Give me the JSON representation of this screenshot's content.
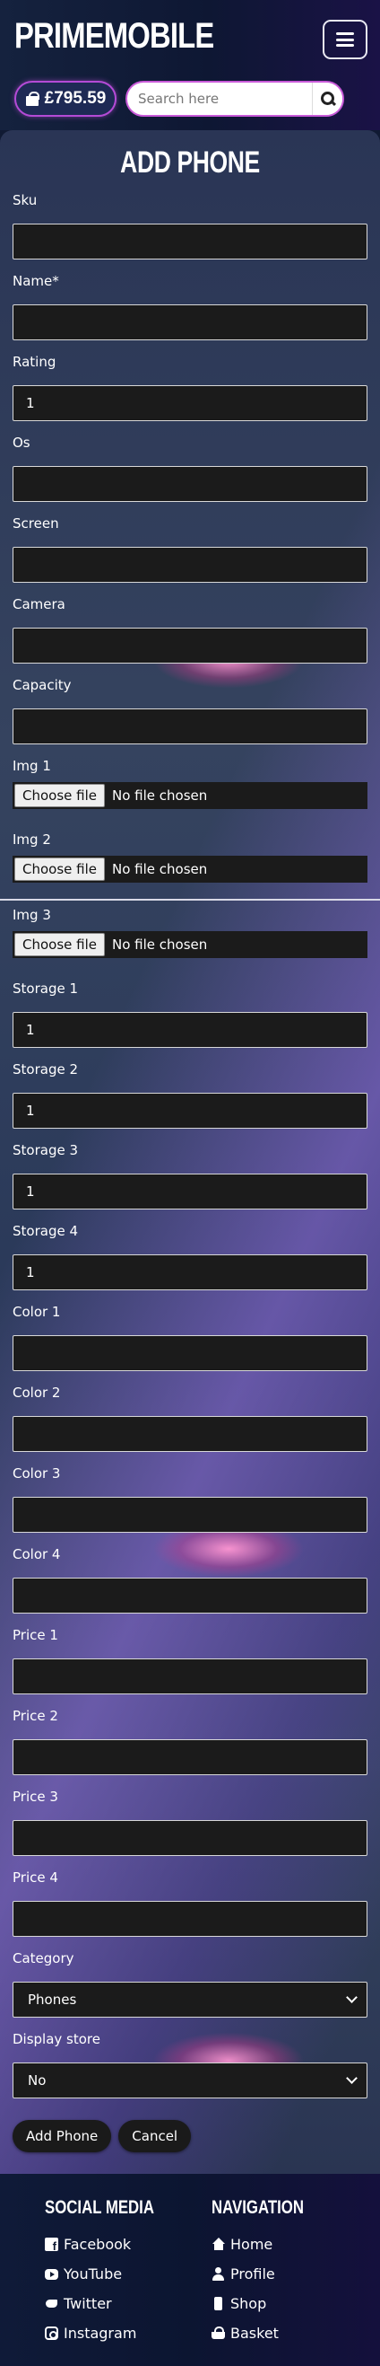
{
  "header": {
    "brand": "PRIMEMOBILE",
    "basket_total": "£795.59",
    "search_placeholder": "Search here"
  },
  "form": {
    "title": "ADD PHONE",
    "fields_top": [
      {
        "label": "Sku",
        "value": ""
      },
      {
        "label": "Name*",
        "value": ""
      },
      {
        "label": "Rating",
        "value": "1"
      },
      {
        "label": "Os",
        "value": ""
      },
      {
        "label": "Screen",
        "value": ""
      },
      {
        "label": "Camera",
        "value": ""
      },
      {
        "label": "Capacity",
        "value": ""
      }
    ],
    "file_fields": [
      {
        "label": "Img 1",
        "button": "Choose file",
        "status": "No file chosen"
      },
      {
        "label": "Img 2",
        "button": "Choose file",
        "status": "No file chosen"
      },
      {
        "label": "Img 3",
        "button": "Choose file",
        "status": "No file chosen"
      }
    ],
    "fields_bottom": [
      {
        "label": "Storage 1",
        "value": "1"
      },
      {
        "label": "Storage 2",
        "value": "1"
      },
      {
        "label": "Storage 3",
        "value": "1"
      },
      {
        "label": "Storage 4",
        "value": "1"
      },
      {
        "label": "Color 1",
        "value": ""
      },
      {
        "label": "Color 2",
        "value": ""
      },
      {
        "label": "Color 3",
        "value": ""
      },
      {
        "label": "Color 4",
        "value": ""
      },
      {
        "label": "Price 1",
        "value": ""
      },
      {
        "label": "Price 2",
        "value": ""
      },
      {
        "label": "Price 3",
        "value": ""
      },
      {
        "label": "Price 4",
        "value": ""
      }
    ],
    "category": {
      "label": "Category",
      "value": "Phones"
    },
    "display_store": {
      "label": "Display store",
      "value": "No"
    },
    "submit_label": "Add Phone",
    "cancel_label": "Cancel"
  },
  "footer": {
    "social_heading": "SOCIAL MEDIA",
    "social_links": [
      {
        "label": "Facebook",
        "icon": "facebook-icon"
      },
      {
        "label": "YouTube",
        "icon": "youtube-icon"
      },
      {
        "label": "Twitter",
        "icon": "twitter-icon"
      },
      {
        "label": "Instagram",
        "icon": "instagram-icon"
      }
    ],
    "nav_heading": "NAVIGATION",
    "nav_links": [
      {
        "label": "Home",
        "icon": "home-icon"
      },
      {
        "label": "Profile",
        "icon": "user-icon"
      },
      {
        "label": "Shop",
        "icon": "phone-icon"
      },
      {
        "label": "Basket",
        "icon": "basket-icon"
      }
    ]
  },
  "colors": {
    "background": "#101a33",
    "accent": "#b44bd6",
    "input_bg": "#1b1b1b"
  }
}
